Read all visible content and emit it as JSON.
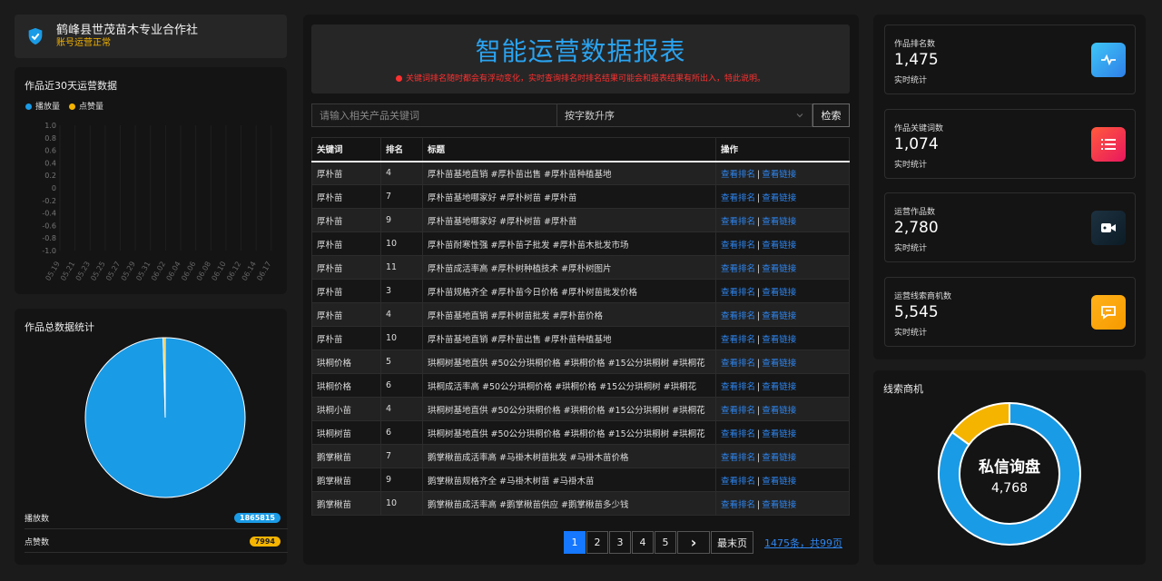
{
  "brand": {
    "title": "鹤峰县世茂苗木专业合作社",
    "status": "账号运营正常"
  },
  "trend": {
    "title": "作品近30天运营数据",
    "legend": [
      {
        "label": "播放量",
        "color": "#1a9be6"
      },
      {
        "label": "点赞量",
        "color": "#f5b400"
      }
    ],
    "y_ticks": [
      "1.0",
      "0.8",
      "0.6",
      "0.4",
      "0.2",
      "0",
      "-0.2",
      "-0.4",
      "-0.6",
      "-0.8",
      "-1.0"
    ],
    "x_ticks": [
      "05.19",
      "05.21",
      "05.23",
      "05.25",
      "05.27",
      "05.29",
      "05.31",
      "06.02",
      "06.04",
      "06.06",
      "06.08",
      "06.10",
      "06.12",
      "06.14",
      "06.17"
    ]
  },
  "totals": {
    "title": "作品总数据统计",
    "play_label": "播放数",
    "play_value": "1865815",
    "play_color": "#1a9be6",
    "like_label": "点赞数",
    "like_value": "7994",
    "like_color": "#f5b400"
  },
  "chart_data": [
    {
      "type": "line",
      "x": [
        "05.19",
        "05.21",
        "05.23",
        "05.25",
        "05.27",
        "05.29",
        "05.31",
        "06.02",
        "06.04",
        "06.06",
        "06.08",
        "06.10",
        "06.12",
        "06.14",
        "06.17"
      ],
      "ylim": [
        -1.0,
        1.0
      ],
      "series": [
        {
          "name": "播放量",
          "values": []
        },
        {
          "name": "点赞量",
          "values": []
        }
      ],
      "legend": "top-left"
    },
    {
      "type": "pie",
      "categories": [
        "播放数",
        "点赞数"
      ],
      "values": [
        1865815,
        7994
      ]
    },
    {
      "type": "pie",
      "title": "私信询盘",
      "total": 4768,
      "values": [
        85,
        15
      ],
      "colors": [
        "#1a9be6",
        "#f5b400"
      ]
    }
  ],
  "header": {
    "title": "智能运营数据报表",
    "notice": "关键词排名随时都会有浮动变化，实时查询排名时排名结果可能会和报表结果有所出入，特此说明。"
  },
  "search": {
    "placeholder": "请输入相关产品关键词",
    "sort_label": "按字数升序",
    "button": "检索"
  },
  "table": {
    "headers": [
      "关键词",
      "排名",
      "标题",
      "操作"
    ],
    "op_rank": "查看排名",
    "op_link": "查看链接",
    "rows": [
      {
        "kw": "厚朴苗",
        "rank": "4",
        "title": "厚朴苗基地直销 #厚朴苗出售 #厚朴苗种植基地"
      },
      {
        "kw": "厚朴苗",
        "rank": "7",
        "title": "厚朴苗基地哪家好 #厚朴树苗 #厚朴苗"
      },
      {
        "kw": "厚朴苗",
        "rank": "9",
        "title": "厚朴苗基地哪家好 #厚朴树苗 #厚朴苗"
      },
      {
        "kw": "厚朴苗",
        "rank": "10",
        "title": "厚朴苗耐寒性强 #厚朴苗子批发 #厚朴苗木批发市场"
      },
      {
        "kw": "厚朴苗",
        "rank": "11",
        "title": "厚朴苗成活率高 #厚朴树种植技术 #厚朴树图片"
      },
      {
        "kw": "厚朴苗",
        "rank": "3",
        "title": "厚朴苗规格齐全 #厚朴苗今日价格 #厚朴树苗批发价格"
      },
      {
        "kw": "厚朴苗",
        "rank": "4",
        "title": "厚朴苗基地直销 #厚朴树苗批发 #厚朴苗价格"
      },
      {
        "kw": "厚朴苗",
        "rank": "10",
        "title": "厚朴苗基地直销 #厚朴苗出售 #厚朴苗种植基地"
      },
      {
        "kw": "珙桐价格",
        "rank": "5",
        "title": "珙桐树基地直供 #50公分珙桐价格 #珙桐价格 #15公分珙桐树 #珙桐花"
      },
      {
        "kw": "珙桐价格",
        "rank": "6",
        "title": "珙桐成活率高 #50公分珙桐价格 #珙桐价格 #15公分珙桐树 #珙桐花"
      },
      {
        "kw": "珙桐小苗",
        "rank": "4",
        "title": "珙桐树基地直供 #50公分珙桐价格 #珙桐价格 #15公分珙桐树 #珙桐花"
      },
      {
        "kw": "珙桐树苗",
        "rank": "6",
        "title": "珙桐树基地直供 #50公分珙桐价格 #珙桐价格 #15公分珙桐树 #珙桐花"
      },
      {
        "kw": "鹅掌楸苗",
        "rank": "7",
        "title": "鹅掌楸苗成活率高 #马褂木树苗批发 #马褂木苗价格"
      },
      {
        "kw": "鹅掌楸苗",
        "rank": "9",
        "title": "鹅掌楸苗规格齐全 #马褂木树苗 #马褂木苗"
      },
      {
        "kw": "鹅掌楸苗",
        "rank": "10",
        "title": "鹅掌楸苗成活率高 #鹅掌楸苗供应 #鹅掌楸苗多少钱"
      }
    ]
  },
  "pager": {
    "pages": [
      "1",
      "2",
      "3",
      "4",
      "5"
    ],
    "next": "›",
    "last": "最末页",
    "total": "1475条，共99页",
    "active": "1"
  },
  "cards": [
    {
      "label": "作品排名数",
      "value": "1,475",
      "sub": "实时统计",
      "icon": "activity-icon",
      "color": "linear-gradient(135deg,#3ec6f7,#2f7fe8)"
    },
    {
      "label": "作品关键词数",
      "value": "1,074",
      "sub": "实时统计",
      "icon": "list-icon",
      "color": "linear-gradient(135deg,#ff5a3c,#e9175e)"
    },
    {
      "label": "运营作品数",
      "value": "2,780",
      "sub": "实时统计",
      "icon": "video-icon",
      "color": "linear-gradient(135deg,#1d3140,#0c1c26)"
    },
    {
      "label": "运营线索商机数",
      "value": "5,545",
      "sub": "实时统计",
      "icon": "message-icon",
      "color": "linear-gradient(135deg,#ffb21a,#f79a00)"
    }
  ],
  "leads": {
    "title": "线索商机",
    "center_label": "私信询盘",
    "center_value": "4,768"
  }
}
